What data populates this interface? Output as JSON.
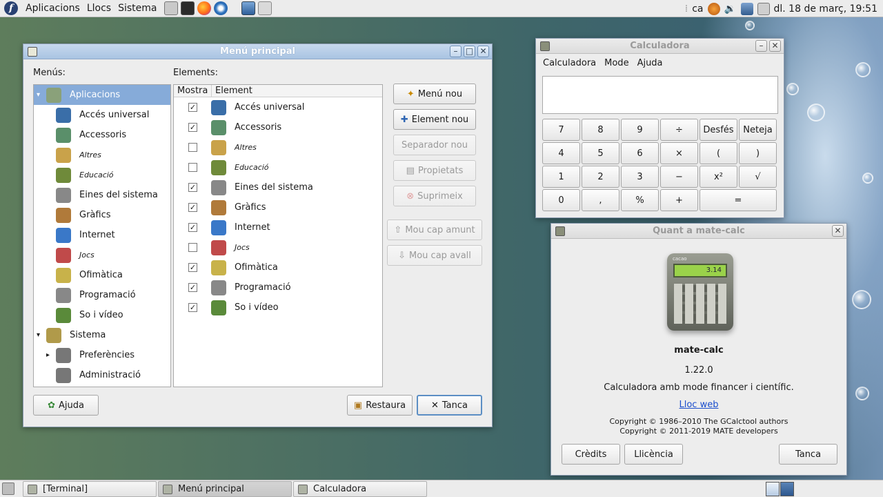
{
  "top_panel": {
    "menus": [
      "Aplicacions",
      "Llocs",
      "Sistema"
    ],
    "tray": {
      "keyboard_layout": "ca",
      "clock": "dl. 18 de març, 19:51"
    }
  },
  "menu_editor": {
    "title": "Menú principal",
    "menus_label": "Menús:",
    "elements_label": "Elements:",
    "menus_tree": [
      {
        "label": "Aplicacions",
        "italic": false,
        "selected": true
      },
      {
        "label": "Accés universal",
        "italic": false
      },
      {
        "label": "Accessoris",
        "italic": false
      },
      {
        "label": "Altres",
        "italic": true
      },
      {
        "label": "Educació",
        "italic": true
      },
      {
        "label": "Eines del sistema",
        "italic": false
      },
      {
        "label": "Gràfics",
        "italic": false
      },
      {
        "label": "Internet",
        "italic": false
      },
      {
        "label": "Jocs",
        "italic": true
      },
      {
        "label": "Ofimàtica",
        "italic": false
      },
      {
        "label": "Programació",
        "italic": false
      },
      {
        "label": "So i vídeo",
        "italic": false
      },
      {
        "label": "Sistema",
        "italic": false
      },
      {
        "label": "Preferències",
        "italic": false
      },
      {
        "label": "Administració",
        "italic": false
      }
    ],
    "columns": {
      "show": "Mostra",
      "element": "Element"
    },
    "elements": [
      {
        "label": "Accés universal",
        "checked": true,
        "italic": false
      },
      {
        "label": "Accessoris",
        "checked": true,
        "italic": false
      },
      {
        "label": "Altres",
        "checked": false,
        "italic": true
      },
      {
        "label": "Educació",
        "checked": false,
        "italic": true
      },
      {
        "label": "Eines del sistema",
        "checked": true,
        "italic": false
      },
      {
        "label": "Gràfics",
        "checked": true,
        "italic": false
      },
      {
        "label": "Internet",
        "checked": true,
        "italic": false
      },
      {
        "label": "Jocs",
        "checked": false,
        "italic": true
      },
      {
        "label": "Ofimàtica",
        "checked": true,
        "italic": false
      },
      {
        "label": "Programació",
        "checked": true,
        "italic": false
      },
      {
        "label": "So i vídeo",
        "checked": true,
        "italic": false
      }
    ],
    "buttons": {
      "new_menu": "Menú nou",
      "new_item": "Element nou",
      "new_separator": "Separador nou",
      "properties": "Propietats",
      "delete": "Suprimeix",
      "move_up": "Mou cap amunt",
      "move_down": "Mou cap avall",
      "help": "Ajuda",
      "restore": "Restaura",
      "close": "Tanca"
    }
  },
  "calculator": {
    "title": "Calculadora",
    "menu": [
      "Calculadora",
      "Mode",
      "Ajuda"
    ],
    "display": "",
    "keys": [
      [
        "7",
        "8",
        "9",
        "÷",
        "Desfés",
        "Neteja"
      ],
      [
        "4",
        "5",
        "6",
        "×",
        "(",
        ")"
      ],
      [
        "1",
        "2",
        "3",
        "−",
        "x²",
        "√"
      ],
      [
        "0",
        ",",
        "%",
        "+",
        "="
      ]
    ]
  },
  "about": {
    "title": "Quant a mate-calc",
    "app_name": "mate-calc",
    "version": "1.22.0",
    "comment": "Calculadora amb mode financer i científic.",
    "website": "Lloc web",
    "copyright1": "Copyright © 1986–2010 The GCalctool authors",
    "copyright2": "Copyright © 2011-2019 MATE developers",
    "icon_brand": "cacao",
    "icon_display": "3.14",
    "buttons": {
      "credits": "Crèdits",
      "license": "Llicència",
      "close": "Tanca"
    }
  },
  "taskbar": {
    "tasks": [
      {
        "label": "[Terminal]",
        "active": false
      },
      {
        "label": "Menú principal",
        "active": true
      },
      {
        "label": "Calculadora",
        "active": false
      }
    ]
  },
  "colors": {
    "selection": "#86abd9",
    "titlebar_active": "#a9c4e2",
    "link": "#1a4dcc"
  }
}
